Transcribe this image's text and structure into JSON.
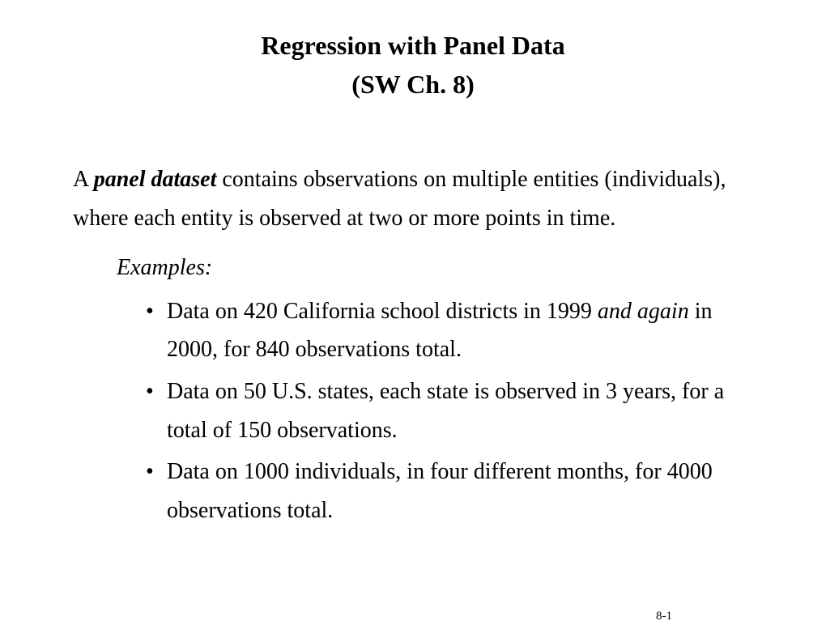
{
  "title": {
    "line1": "Regression with Panel Data",
    "line2": "(SW Ch. 8)"
  },
  "definition": {
    "prefix": "A ",
    "term": "panel dataset",
    "rest": " contains observations on multiple entities (individuals), where each entity is observed at two or more points in time."
  },
  "examples_label": "Examples",
  "bullets": [
    {
      "pre": "Data on 420 California school districts in 1999 ",
      "italic": "and again",
      "post": " in 2000, for 840 observations total."
    },
    {
      "pre": "Data on 50 U.S. states, each state is observed in 3 years, for a total of 150 observations.",
      "italic": "",
      "post": ""
    },
    {
      "pre": "Data on 1000 individuals, in four different months, for 4000 observations total.",
      "italic": "",
      "post": ""
    }
  ],
  "page_number": "8-1"
}
